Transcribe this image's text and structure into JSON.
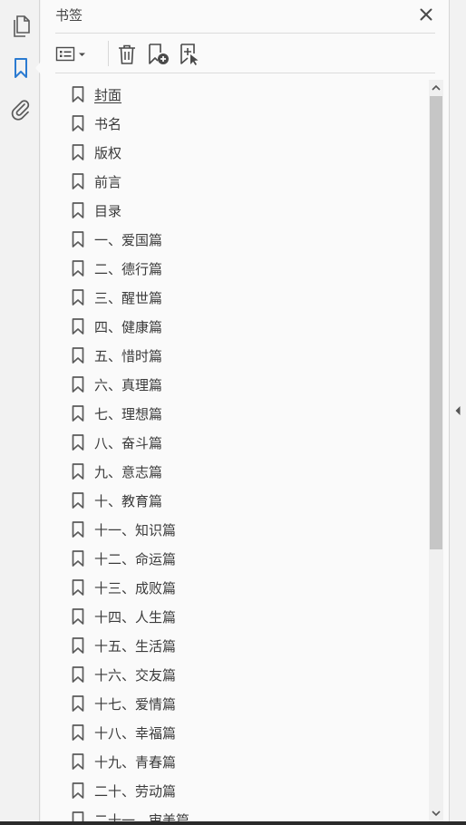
{
  "panel": {
    "title": "书签"
  },
  "rail": {
    "icons": [
      "pages-icon",
      "bookmark-icon",
      "attachment-icon"
    ],
    "active": "bookmark-icon",
    "accent_color": "#2b7bd1"
  },
  "toolbar": {
    "buttons": [
      "options-menu-icon",
      "delete-icon",
      "new-bookmark-icon",
      "new-bookmark-from-structure-icon"
    ]
  },
  "bookmarks": [
    "封面",
    "书名",
    "版权",
    "前言",
    "目录",
    "一、爱国篇",
    "二、德行篇",
    "三、醒世篇",
    "四、健康篇",
    "五、惜时篇",
    "六、真理篇",
    "七、理想篇",
    "八、奋斗篇",
    "九、意志篇",
    "十、教育篇",
    "十一、知识篇",
    "十二、命运篇",
    "十三、成败篇",
    "十四、人生篇",
    "十五、生活篇",
    "十六、交友篇",
    "十七、爱情篇",
    "十八、幸福篇",
    "十九、青春篇",
    "二十、劳动篇",
    "二十一、审美篇"
  ]
}
